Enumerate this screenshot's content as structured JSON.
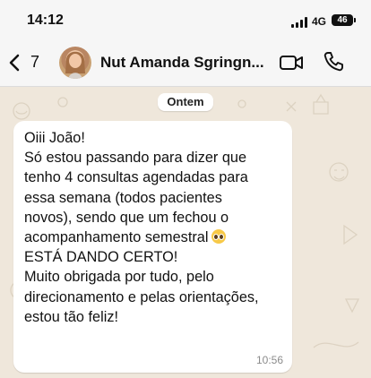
{
  "status_bar": {
    "time": "14:12",
    "network": "4G",
    "battery": "46"
  },
  "header": {
    "back_count": "7",
    "contact_name": "Nut Amanda Sgringn..."
  },
  "chat": {
    "date_label": "Ontem",
    "message": {
      "lines": [
        "Oiii João!",
        "Só estou passando para dizer que",
        "tenho 4 consultas agendadas para",
        "essa semana (todos pacientes",
        "novos), sendo que um fechou o",
        "acompanhamento semestral",
        "ESTÁ DANDO CERTO!",
        "Muito obrigada por tudo, pelo",
        "direcionamento e pelas orientações,",
        "estou tão feliz!"
      ],
      "time": "10:56",
      "emoji": "pleading-face-emoji"
    }
  },
  "icons": {
    "back": "chevron-left-icon",
    "video": "video-camera-icon",
    "call": "phone-icon",
    "signal": "cellular-signal-icon",
    "battery": "battery-icon"
  },
  "colors": {
    "background": "#efe7db",
    "bubble": "#ffffff",
    "header": "#f6f6f6"
  }
}
